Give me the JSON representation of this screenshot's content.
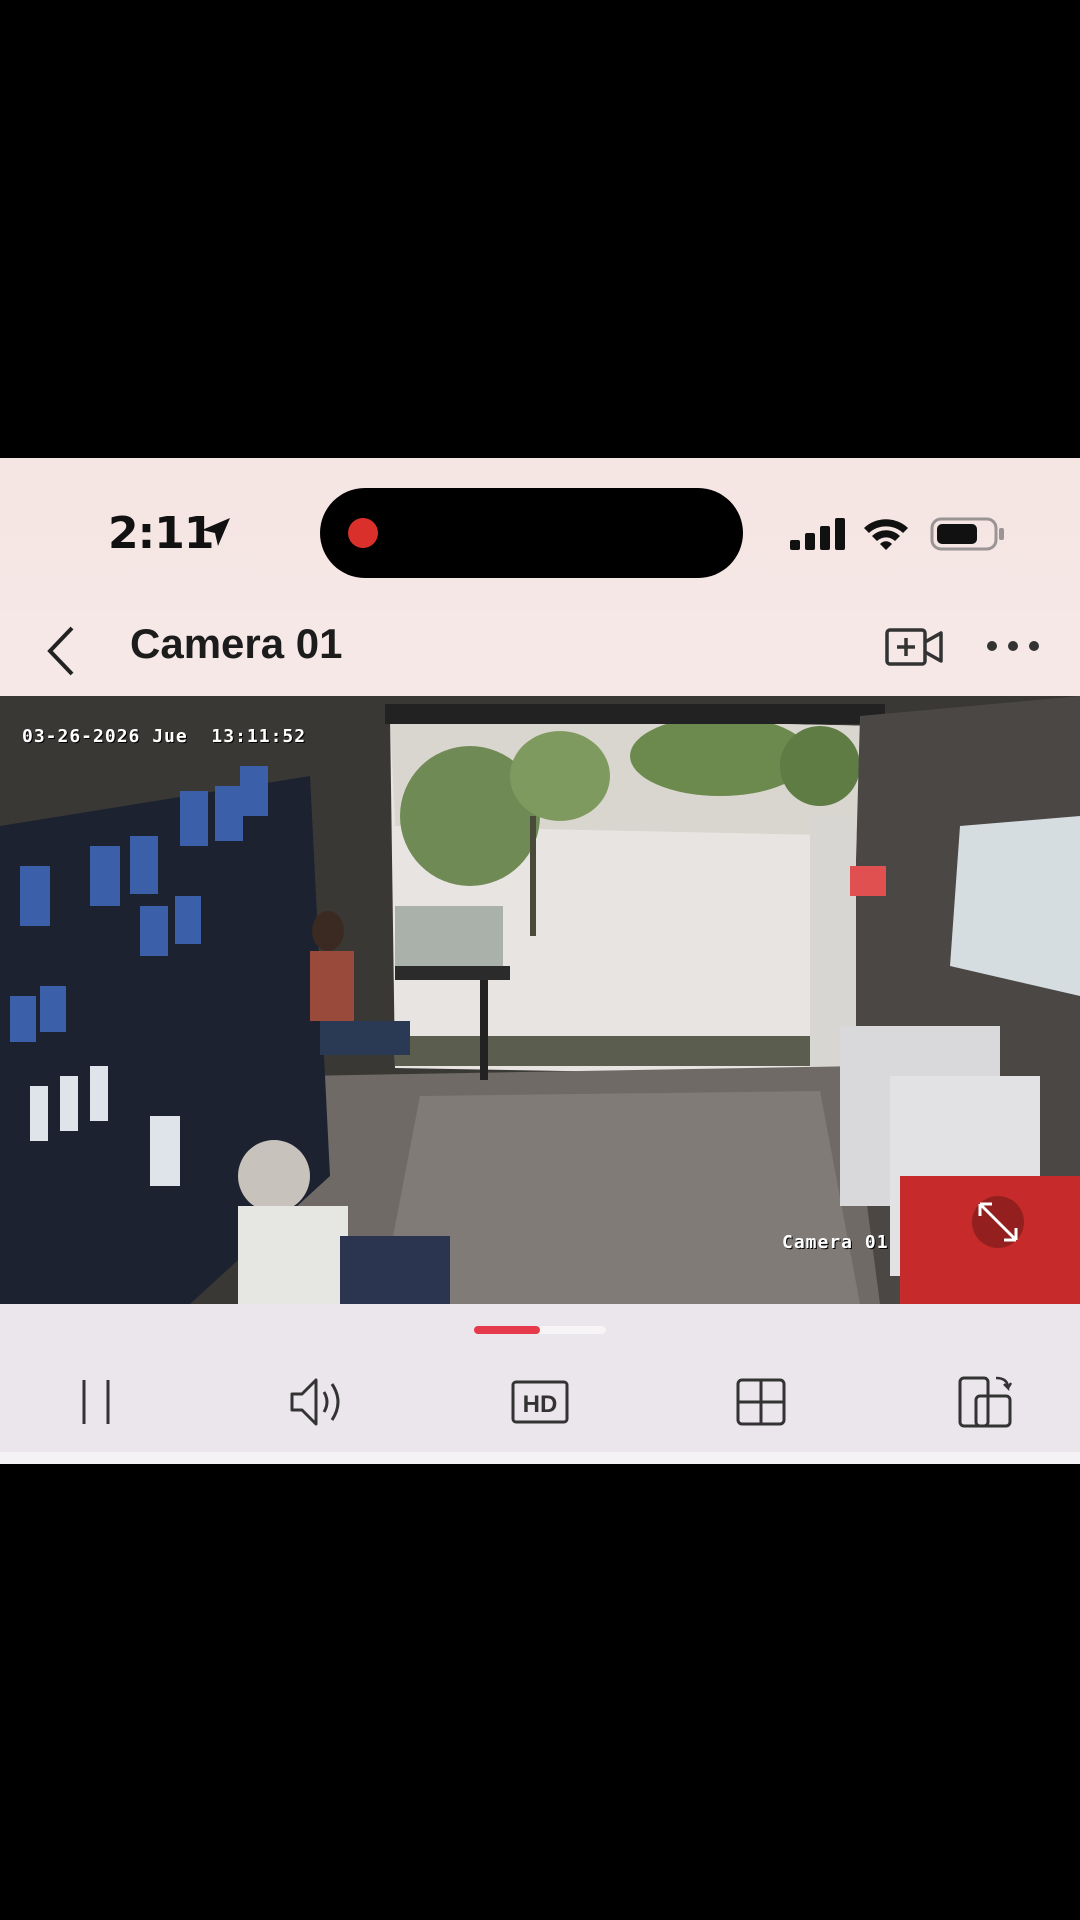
{
  "status_bar": {
    "time": "2:11"
  },
  "nav": {
    "title": "Camera 01"
  },
  "video": {
    "osd_datetime": "03-26-2026 Jue  13:11:52",
    "osd_camera": "Camera 01"
  },
  "playback": {
    "progress": 0.5
  },
  "colors": {
    "accent": "#e6394a",
    "record": "#d9302b",
    "header_bg": "#f5e8e6",
    "controls_bg": "#ebe6eb"
  },
  "icons": {
    "location": "location-arrow-icon",
    "signal": "cellular-signal-icon",
    "wifi": "wifi-icon",
    "battery": "battery-icon",
    "back": "chevron-left-icon",
    "add_video": "add-video-icon",
    "more": "more-icon",
    "fullscreen": "fullscreen-icon",
    "pause": "pause-icon",
    "volume": "volume-icon",
    "hd": "hd-icon",
    "grid": "grid-icon",
    "orientation": "orientation-icon"
  }
}
